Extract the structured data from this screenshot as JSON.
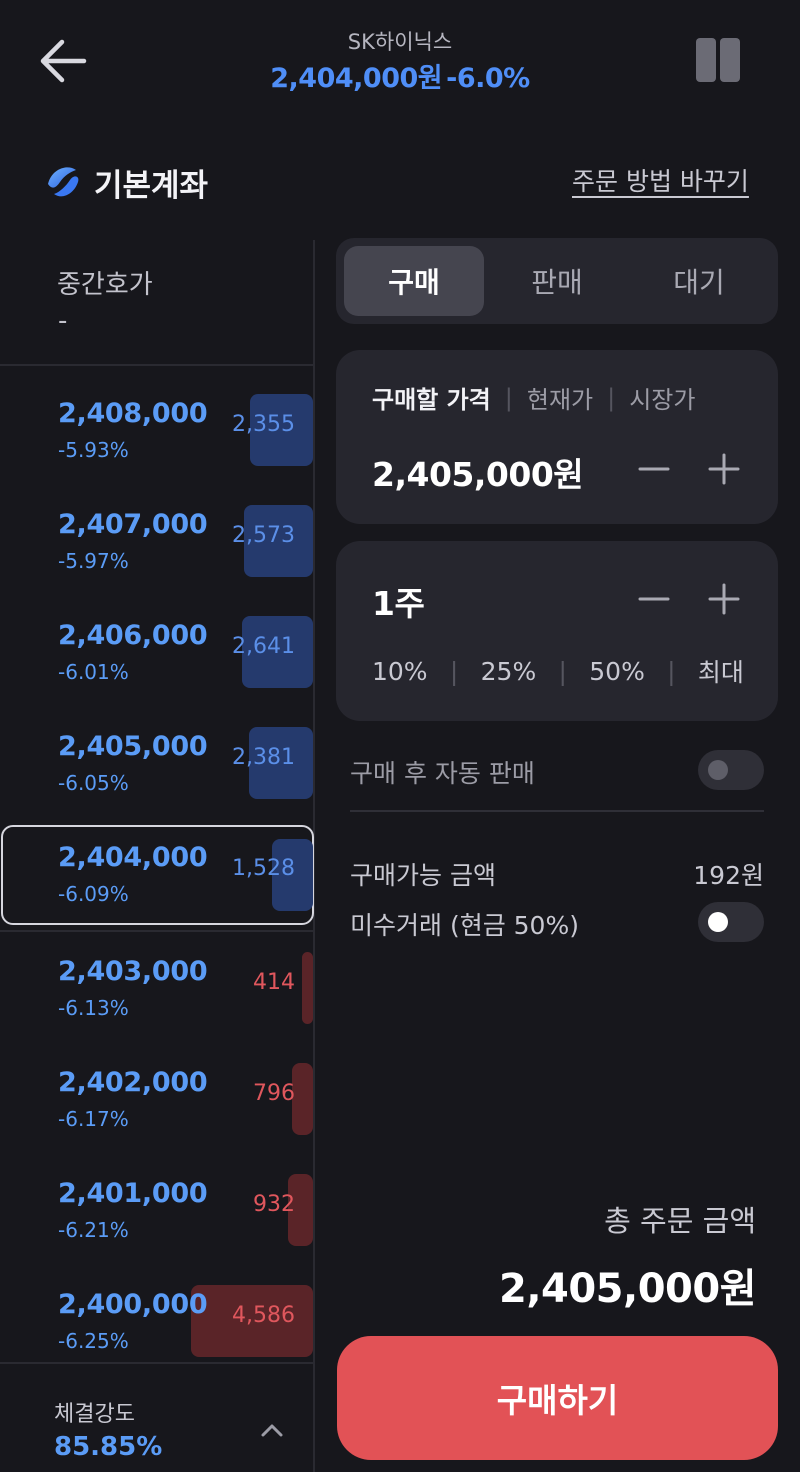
{
  "header": {
    "stock_name": "SK하이닉스",
    "price": "2,404,000원",
    "change_rate": "-6.0%",
    "back_icon": "arrow-left-icon",
    "chart_toggle_icon": "pause-bars-icon"
  },
  "account": {
    "name": "기본계좌",
    "icon": "toss-logo-icon",
    "change_method": "주문 방법 바꾸기"
  },
  "orderbook": {
    "mid_label": "중간호가",
    "mid_value": "-",
    "asks": [
      {
        "price": "2,408,000",
        "rate": "-5.93%",
        "qty": "2,355"
      },
      {
        "price": "2,407,000",
        "rate": "-5.97%",
        "qty": "2,573"
      },
      {
        "price": "2,406,000",
        "rate": "-6.01%",
        "qty": "2,641"
      },
      {
        "price": "2,405,000",
        "rate": "-6.05%",
        "qty": "2,381"
      },
      {
        "price": "2,404,000",
        "rate": "-6.09%",
        "qty": "1,528"
      }
    ],
    "bids": [
      {
        "price": "2,403,000",
        "rate": "-6.13%",
        "qty": "414"
      },
      {
        "price": "2,402,000",
        "rate": "-6.17%",
        "qty": "796"
      },
      {
        "price": "2,401,000",
        "rate": "-6.21%",
        "qty": "932"
      },
      {
        "price": "2,400,000",
        "rate": "-6.25%",
        "qty": "4,586"
      }
    ],
    "strength_label": "체결강도",
    "strength_value": "85.85%"
  },
  "order": {
    "tabs": [
      "구매",
      "판매",
      "대기"
    ],
    "active_tab": "구매",
    "price_tabs": [
      "구매할 가격",
      "현재가",
      "시장가"
    ],
    "price_value": "2,405,000원",
    "quantity_value": "1주",
    "percent_options": [
      "10%",
      "25%",
      "50%",
      "최대"
    ],
    "auto_sell_label": "구매 후 자동 판매",
    "auto_sell_on": false,
    "available_label": "구매가능 금액",
    "available_value": "192원",
    "margin_label": "미수거래 (현금 50%)",
    "margin_on": true,
    "total_label": "총 주문 금액",
    "total_value": "2,405,000원",
    "buy_button": "구매하기"
  },
  "colors": {
    "background": "#17171c",
    "panel": "#26262e",
    "blue": "#5b9cf6",
    "red": "#e0575d",
    "buy_button": "#e25256"
  }
}
